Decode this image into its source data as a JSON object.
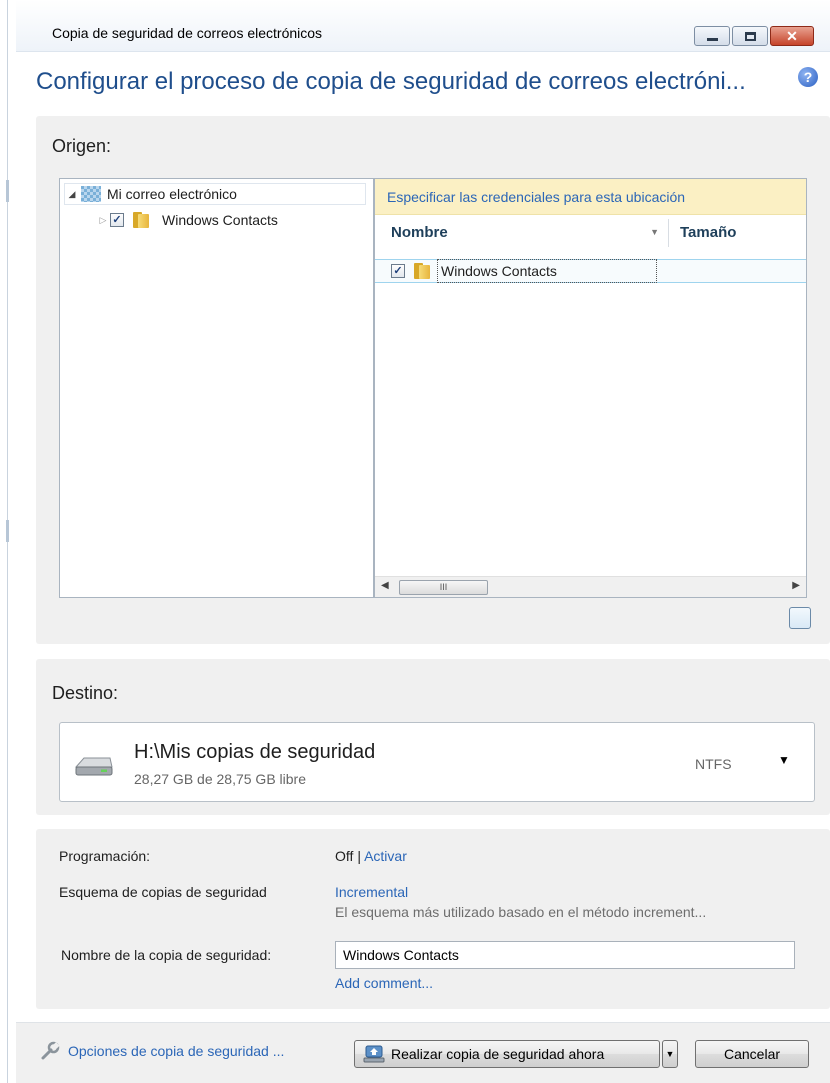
{
  "window": {
    "title": "Copia de seguridad de correos electrónicos",
    "heading": "Configurar el proceso de copia de seguridad de correos electróni..."
  },
  "origin": {
    "label": "Origen:",
    "tree": {
      "root_label": "Mi correo electrónico",
      "child_label": "Windows Contacts",
      "child_checked": true
    },
    "list": {
      "credentials_link": "Especificar las credenciales para esta ubicación",
      "columns": [
        "Nombre",
        "Tamaño"
      ],
      "rows": [
        {
          "name": "Windows Contacts",
          "checked": true
        }
      ]
    },
    "scroll_thumb_label": "III"
  },
  "destination": {
    "label": "Destino:",
    "path": "H:\\Mis copias de seguridad",
    "free_space": "28,27 GB de 28,75 GB libre",
    "filesystem": "NTFS"
  },
  "settings": {
    "schedule_label": "Programación:",
    "schedule_value": "Off",
    "schedule_separator": "|",
    "schedule_action": "Activar",
    "scheme_label": "Esquema de copias de seguridad",
    "scheme_value": "Incremental",
    "scheme_description": "El esquema más utilizado basado en el método increment...",
    "backup_name_label": "Nombre de la copia de seguridad:",
    "backup_name_value": "Windows Contacts",
    "add_comment": "Add comment..."
  },
  "footer": {
    "options_link": "Opciones de copia de seguridad ...",
    "backup_now": "Realizar copia de seguridad ahora",
    "cancel": "Cancelar"
  },
  "colors": {
    "heading_blue": "#1f4e8c",
    "link_blue": "#2b66b7",
    "section_bg": "#f0f0f0",
    "credentials_bg": "#fbf0c4"
  }
}
